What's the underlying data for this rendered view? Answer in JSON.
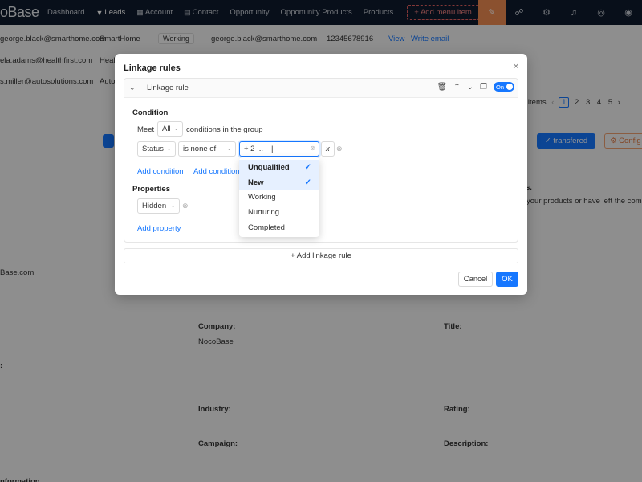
{
  "nav": {
    "logo": "oBase",
    "items": [
      {
        "label": "Dashboard",
        "icon": ""
      },
      {
        "label": "Leads",
        "icon": "filter-icon"
      },
      {
        "label": "Account",
        "icon": "building-icon"
      },
      {
        "label": "Contact",
        "icon": "contact-icon"
      },
      {
        "label": "Opportunity",
        "icon": ""
      },
      {
        "label": "Opportunity Products",
        "icon": ""
      },
      {
        "label": "Products",
        "icon": ""
      }
    ],
    "add_menu": "+ Add menu item"
  },
  "background": {
    "rows": [
      {
        "email": "george.black@smarthome.com",
        "company": "SmartHome",
        "status": "Working",
        "email2": "george.black@smarthome.com",
        "phone": "12345678916",
        "view": "View",
        "write": "Write email"
      },
      {
        "email": "ela.adams@healthfirst.com",
        "company": "Heal"
      },
      {
        "email": "s.miller@autosolutions.com",
        "company": "Auto"
      }
    ],
    "pagination": {
      "items": "8 items",
      "pages": [
        "1",
        "2",
        "3",
        "4",
        "5"
      ]
    },
    "buttons": {
      "transferred": "transfered",
      "config": "Config"
    },
    "notes": {
      "dot": "s.",
      "text": "your products or have left the comp"
    },
    "fields": {
      "email_frag": "Base.com",
      "company_label": "Company:",
      "company_value": "NocoBase",
      "title_label": "Title:",
      "industry_label": "Industry:",
      "rating_label": "Rating:",
      "campaign_label": "Campaign:",
      "description_label": "Description:",
      "colon": ":",
      "info_frag": "nformation"
    }
  },
  "modal": {
    "title": "Linkage rules",
    "rule_name": "Linkage rule",
    "toggle": "On",
    "condition_label": "Condition",
    "meet": "Meet",
    "meet_value": "All",
    "meet_suffix": "conditions in the group",
    "field": "Status",
    "operator": "is none of",
    "value_display": "+ 2 ...",
    "x_label": "x",
    "add_condition": "Add condition",
    "add_condition_group": "Add condition",
    "properties_label": "Properties",
    "property_value": "Hidden",
    "add_property": "Add property",
    "add_linkage_rule": "+ Add linkage rule",
    "cancel": "Cancel",
    "ok": "OK"
  },
  "dropdown": {
    "options": [
      {
        "label": "Unqualified",
        "selected": true
      },
      {
        "label": "New",
        "selected": true
      },
      {
        "label": "Working",
        "selected": false
      },
      {
        "label": "Nurturing",
        "selected": false
      },
      {
        "label": "Completed",
        "selected": false
      }
    ]
  }
}
